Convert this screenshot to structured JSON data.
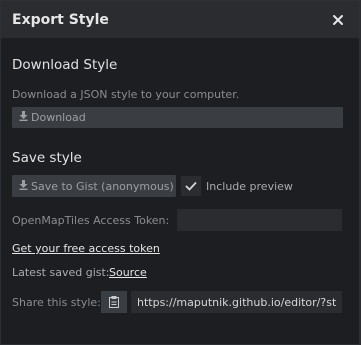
{
  "modal": {
    "title": "Export Style",
    "close_icon": "close-icon"
  },
  "download": {
    "heading": "Download Style",
    "description": "Download a JSON style to your computer.",
    "button_label": "Download",
    "button_icon": "download-icon"
  },
  "save": {
    "heading": "Save style",
    "gist_button_label": "Save to Gist (anonymous)",
    "gist_button_icon": "download-icon",
    "include_preview_label": "Include preview",
    "include_preview_checked": true,
    "token_label": "OpenMapTiles Access Token:",
    "token_value": "",
    "free_token_link": "Get your free access token",
    "latest_gist_label": "Latest saved gist:",
    "latest_gist_link": "Source",
    "share_label": "Share this style:",
    "share_icon": "clipboard-icon",
    "share_url": "https://maputnik.github.io/editor/?style=https://gist.githubusercontent.com/..."
  },
  "colors": {
    "background": "#1c1e21",
    "header": "#2a2c30",
    "button": "#3a3d42",
    "text": "#e6e6e6"
  }
}
